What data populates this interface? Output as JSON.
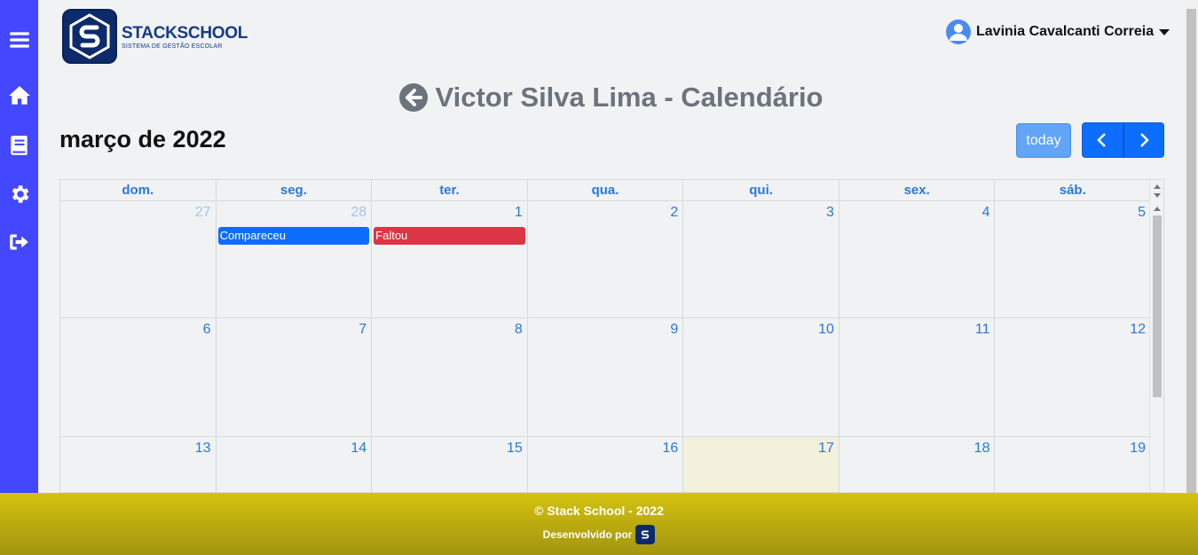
{
  "app": {
    "logo_title": "STACKSCHOOL",
    "logo_subtitle": "SISTEMA DE GESTÃO ESCOLAR"
  },
  "sidebar": {
    "items": [
      {
        "icon": "menu-icon"
      },
      {
        "icon": "home-icon"
      },
      {
        "icon": "book-icon"
      },
      {
        "icon": "gear-icon"
      },
      {
        "icon": "logout-icon"
      }
    ]
  },
  "user": {
    "name": "Lavinia Cavalcanti Correia"
  },
  "page": {
    "title": "Victor Silva Lima - Calendário"
  },
  "calendar": {
    "month_title": "março de 2022",
    "today_label": "today",
    "weekdays": [
      "dom.",
      "seg.",
      "ter.",
      "qua.",
      "qui.",
      "sex.",
      "sáb."
    ],
    "weeks": [
      [
        {
          "day": "27",
          "other": true
        },
        {
          "day": "28",
          "other": true,
          "event": {
            "label": "Compareceu",
            "color": "#0d6efd"
          }
        },
        {
          "day": "1",
          "event": {
            "label": "Faltou",
            "color": "#dc3545"
          }
        },
        {
          "day": "2"
        },
        {
          "day": "3"
        },
        {
          "day": "4"
        },
        {
          "day": "5"
        }
      ],
      [
        {
          "day": "6"
        },
        {
          "day": "7"
        },
        {
          "day": "8"
        },
        {
          "day": "9"
        },
        {
          "day": "10"
        },
        {
          "day": "11"
        },
        {
          "day": "12"
        }
      ],
      [
        {
          "day": "13"
        },
        {
          "day": "14"
        },
        {
          "day": "15"
        },
        {
          "day": "16"
        },
        {
          "day": "17",
          "today": true
        },
        {
          "day": "18"
        },
        {
          "day": "19"
        }
      ]
    ]
  },
  "footer": {
    "copyright": "© Stack School - 2022",
    "developed_by": "Desenvolvido por"
  },
  "colors": {
    "sidebar": "#4348ff",
    "primary": "#0d6efd",
    "danger": "#dc3545",
    "footer": "#d4c20f",
    "today_cell": "#f3f0dc"
  }
}
